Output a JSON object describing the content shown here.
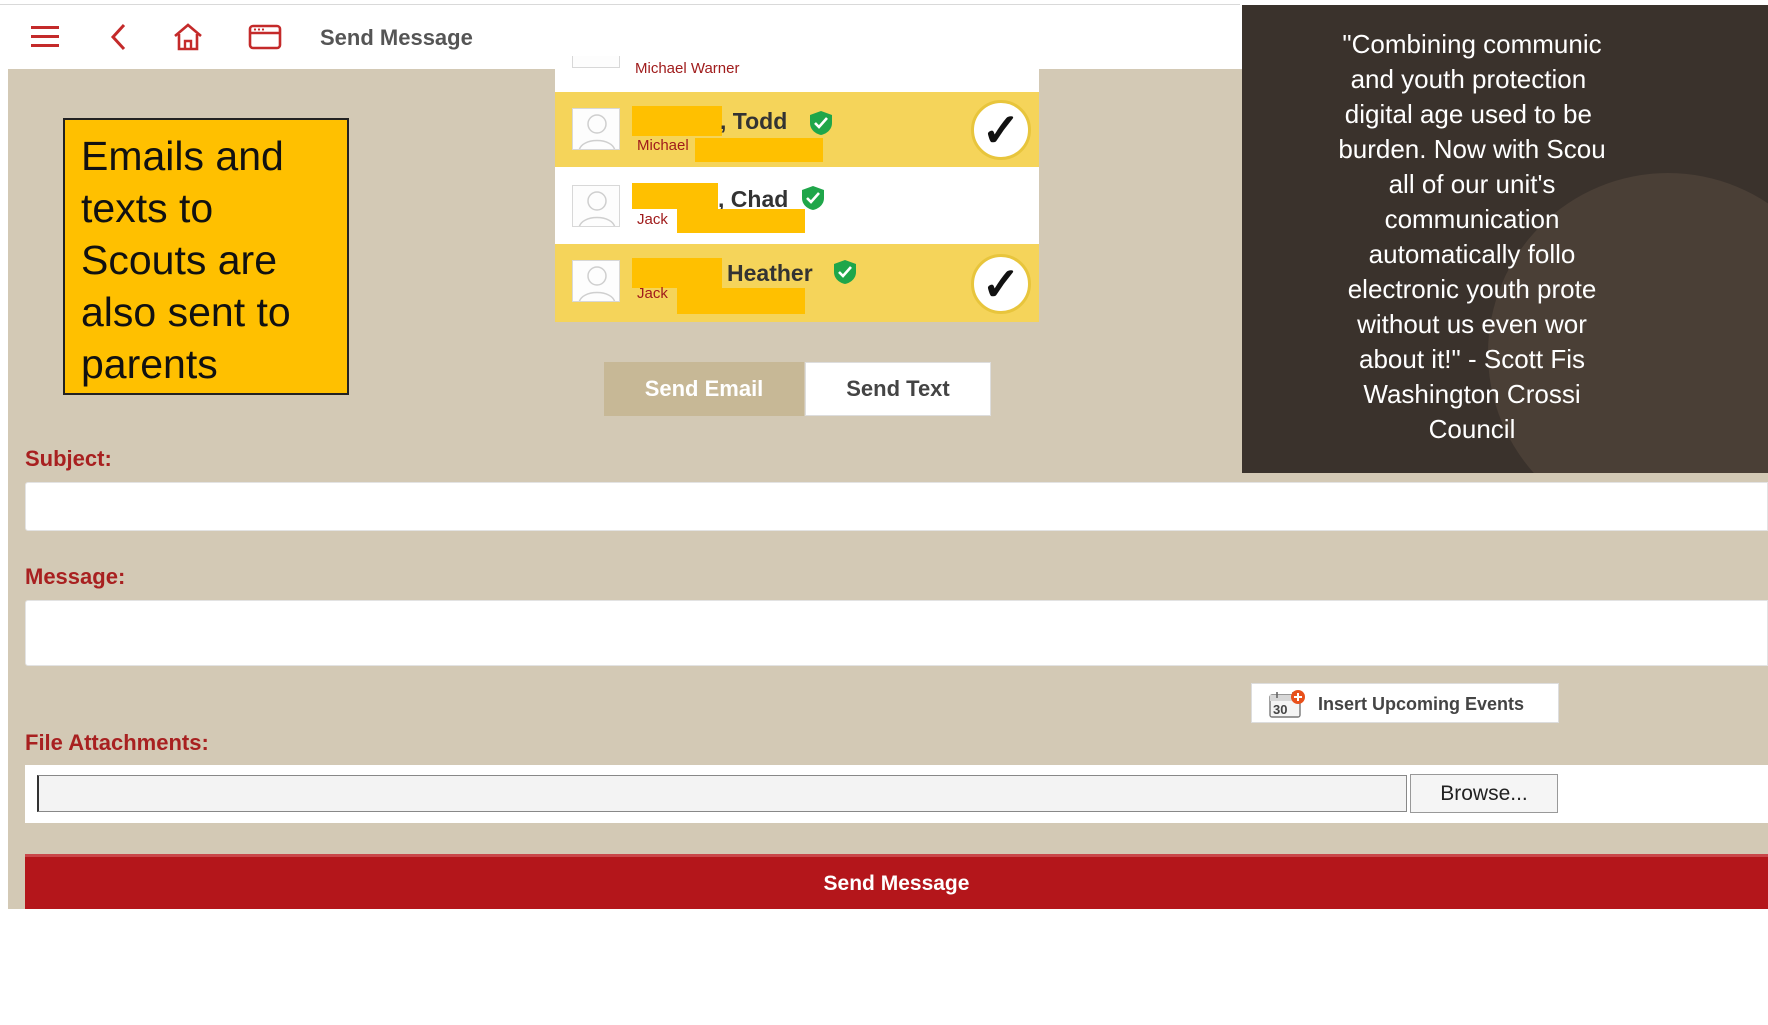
{
  "header": {
    "title": "Send Message",
    "icons": [
      "menu-icon",
      "back-icon",
      "home-icon",
      "browser-window-icon"
    ]
  },
  "callout": {
    "text": "Emails and texts to Scouts are also sent to parents"
  },
  "members": {
    "clipped_name": "Michael Warner",
    "rows": [
      {
        "name": ", Todd",
        "parent": "Michael",
        "selected": true
      },
      {
        "name": ", Chad",
        "parent": "Jack",
        "selected": false
      },
      {
        "name": "Heather",
        "parent": "Jack",
        "selected": true
      }
    ],
    "check_glyph": "✓"
  },
  "mode": {
    "email_label": "Send Email",
    "text_label": "Send Text",
    "active": "email"
  },
  "quote": {
    "text": "\"Combining communic\nand youth protection \ndigital age used to be \nburden. Now with Scou\nall of our unit's\ncommunication\nautomatically follo\nelectronic youth prote\nwithout us even wor\nabout it!\" - Scott Fis\nWashington Crossi\nCouncil"
  },
  "form": {
    "subject_label": "Subject:",
    "subject_value": "",
    "message_label": "Message:",
    "message_value": "",
    "insert_events_label": "Insert Upcoming Events",
    "calendar_day": "30",
    "attachments_label": "File Attachments:",
    "browse_label": "Browse...",
    "send_label": "Send Message"
  },
  "colors": {
    "accent": "#b4161b",
    "beige": "#d3c9b5",
    "selected_row": "#f5d45a",
    "callout": "#ffc000",
    "verified": "#1fa64a"
  }
}
